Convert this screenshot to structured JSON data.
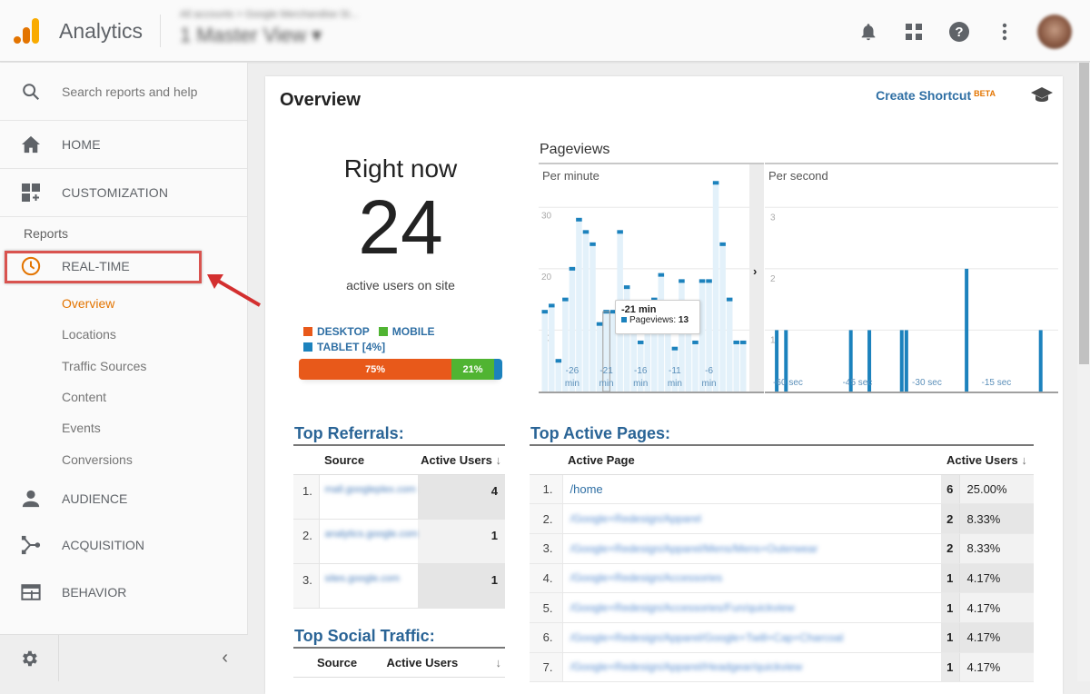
{
  "header": {
    "app_name": "Analytics",
    "account_breadcrumb": "All accounts > Google Merchandise St...",
    "view_name": "1 Master View",
    "icons": [
      "bell-icon",
      "apps-grid-icon",
      "help-icon",
      "more-vert-icon",
      "avatar"
    ]
  },
  "sidebar": {
    "search_placeholder": "Search reports and help",
    "home_label": "HOME",
    "customization_label": "CUSTOMIZATION",
    "reports_label": "Reports",
    "realtime_label": "REAL-TIME",
    "realtime_items": [
      {
        "label": "Overview",
        "active": true
      },
      {
        "label": "Locations",
        "active": false
      },
      {
        "label": "Traffic Sources",
        "active": false
      },
      {
        "label": "Content",
        "active": false
      },
      {
        "label": "Events",
        "active": false
      },
      {
        "label": "Conversions",
        "active": false
      }
    ],
    "sections": [
      {
        "label": "AUDIENCE",
        "icon": "person-icon"
      },
      {
        "label": "ACQUISITION",
        "icon": "acquisition-icon"
      },
      {
        "label": "BEHAVIOR",
        "icon": "behavior-icon"
      }
    ],
    "collapse_glyph": "‹"
  },
  "main": {
    "title": "Overview",
    "create_shortcut": "Create Shortcut",
    "beta": "BETA",
    "right_now": {
      "label": "Right now",
      "count": "24",
      "caption": "active users on site"
    },
    "devices": {
      "legend": [
        {
          "label": "DESKTOP",
          "color": "#e8591a"
        },
        {
          "label": "MOBILE",
          "color": "#50b432"
        },
        {
          "label": "TABLET [4%]",
          "color": "#1c82bd"
        }
      ],
      "bar": [
        {
          "name": "desktop",
          "percent": 75,
          "label": "75%",
          "color": "#e8591a"
        },
        {
          "name": "mobile",
          "percent": 21,
          "label": "21%",
          "color": "#50b432"
        },
        {
          "name": "tablet",
          "percent": 4,
          "label": "",
          "color": "#1c82bd"
        }
      ]
    },
    "pageviews_title": "Pageviews",
    "tooltip": {
      "title": "-21 min",
      "label": "Pageviews:",
      "value": "13"
    },
    "expand_glyph": "›",
    "top_referrals": {
      "title": "Top Referrals:",
      "headers": [
        "Source",
        "Active Users"
      ],
      "sort_glyph": "↓",
      "rows": [
        {
          "idx": "1.",
          "source": "mall.googleplex.com",
          "users": "4"
        },
        {
          "idx": "2.",
          "source": "analytics.google.com",
          "users": "1"
        },
        {
          "idx": "3.",
          "source": "sites.google.com",
          "users": "1"
        }
      ]
    },
    "top_social": {
      "title": "Top Social Traffic:",
      "headers": [
        "Source",
        "Active Users"
      ],
      "sort_glyph": "↓"
    },
    "top_pages": {
      "title": "Top Active Pages:",
      "headers": [
        "Active Page",
        "Active Users"
      ],
      "sort_glyph": "↓",
      "rows": [
        {
          "idx": "1.",
          "page": "/home",
          "blurred": false,
          "users": "6",
          "pct": "25.00%"
        },
        {
          "idx": "2.",
          "page": "/Google+Redesign/Apparel",
          "blurred": true,
          "users": "2",
          "pct": "8.33%"
        },
        {
          "idx": "3.",
          "page": "/Google+Redesign/Apparel/Mens/Mens+Outerwear",
          "blurred": true,
          "users": "2",
          "pct": "8.33%"
        },
        {
          "idx": "4.",
          "page": "/Google+Redesign/Accessories",
          "blurred": true,
          "users": "1",
          "pct": "4.17%"
        },
        {
          "idx": "5.",
          "page": "/Google+Redesign/Accessories/Fun/quickview",
          "blurred": true,
          "users": "1",
          "pct": "4.17%"
        },
        {
          "idx": "6.",
          "page": "/Google+Redesign/Apparel/Google+Twill+Cap+Charcoal",
          "blurred": true,
          "users": "1",
          "pct": "4.17%"
        },
        {
          "idx": "7.",
          "page": "/Google+Redesign/Apparel/Headgear/quickview",
          "blurred": true,
          "users": "1",
          "pct": "4.17%"
        }
      ]
    }
  },
  "chart_data": [
    {
      "type": "bar",
      "title": "Per minute",
      "ylabel": "Pageviews",
      "ylim": [
        0,
        37
      ],
      "yticks": [
        10,
        20,
        30
      ],
      "xtick_labels": [
        {
          "at": -26,
          "label": "-26 min"
        },
        {
          "at": -21,
          "label": "-21 min"
        },
        {
          "at": -16,
          "label": "-16 min"
        },
        {
          "at": -11,
          "label": "-11 min"
        },
        {
          "at": -6,
          "label": "-6 min"
        }
      ],
      "x": [
        -30,
        -29,
        -28,
        -27,
        -26,
        -25,
        -24,
        -23,
        -22,
        -21,
        -20,
        -19,
        -18,
        -17,
        -16,
        -15,
        -14,
        -13,
        -12,
        -11,
        -10,
        -9,
        -8,
        -7,
        -6,
        -5,
        -4,
        -3,
        -2,
        -1
      ],
      "values": [
        13,
        14,
        5,
        15,
        20,
        28,
        26,
        24,
        11,
        13,
        13,
        26,
        17,
        12,
        8,
        12,
        15,
        19,
        14,
        7,
        18,
        13,
        8,
        18,
        18,
        34,
        24,
        15,
        8,
        8
      ],
      "highlight": {
        "x": -21,
        "value": 13
      }
    },
    {
      "type": "bar",
      "title": "Per second",
      "ylim": [
        0,
        3.7
      ],
      "yticks": [
        1,
        2,
        3
      ],
      "xtick_labels": [
        {
          "at": -60,
          "label": "-60 sec"
        },
        {
          "at": -45,
          "label": "-45 sec"
        },
        {
          "at": -30,
          "label": "-30 sec"
        },
        {
          "at": -15,
          "label": "-15 sec"
        }
      ],
      "points": [
        {
          "x": -60,
          "value": 1
        },
        {
          "x": -58,
          "value": 1
        },
        {
          "x": -44,
          "value": 1
        },
        {
          "x": -40,
          "value": 1
        },
        {
          "x": -33,
          "value": 1
        },
        {
          "x": -32,
          "value": 1
        },
        {
          "x": -19,
          "value": 2
        },
        {
          "x": -3,
          "value": 1
        }
      ]
    }
  ]
}
